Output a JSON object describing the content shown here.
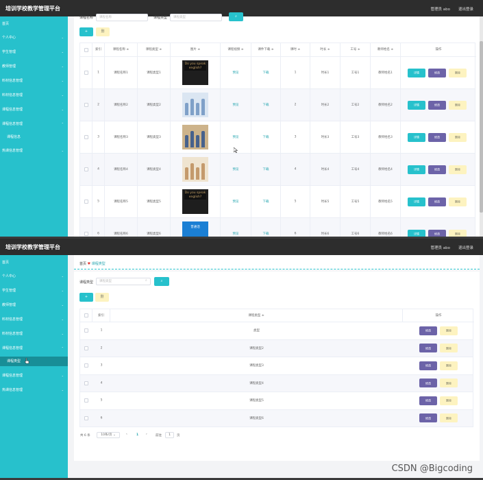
{
  "app": {
    "title": "培训学校教学管理平台",
    "user": "管理员 abo",
    "logout": "退出登录"
  },
  "sidebar1": [
    {
      "label": "首页"
    },
    {
      "label": "个人中心"
    },
    {
      "label": "学生管理"
    },
    {
      "label": "教师管理"
    },
    {
      "label": "料材信息管理"
    },
    {
      "label": "料材信息管理"
    },
    {
      "label": "课程信息管理"
    },
    {
      "label": "课程信息管理"
    },
    {
      "label": "课程信息"
    },
    {
      "label": "热课信息管理"
    }
  ],
  "sidebar2": [
    {
      "label": "首页"
    },
    {
      "label": "个人中心"
    },
    {
      "label": "学生管理"
    },
    {
      "label": "教师管理"
    },
    {
      "label": "料材信息管理"
    },
    {
      "label": "料材信息管理"
    },
    {
      "label": "课程信息管理"
    },
    {
      "label": "课程类型"
    },
    {
      "label": "课程信息管理"
    },
    {
      "label": "热课信息管理"
    }
  ],
  "course": {
    "search": {
      "name_label": "课程名称",
      "name_placeholder": "课程名称",
      "type_label": "课程类型",
      "type_placeholder": "课程类型"
    },
    "add_button": "+",
    "delete_button": "删",
    "columns": [
      "索引",
      "课程名称 ≑",
      "课程类型 ≑",
      "图片 ≑",
      "课程视频 ≑",
      "课件下载 ≑",
      "课时 ≑",
      "时长 ≑",
      "工号 ≑",
      "教师姓名 ≑",
      "操作"
    ],
    "rows": [
      {
        "index": "1",
        "name": "课程名称1",
        "type": "课程类型1",
        "video": "预览",
        "download": "下载",
        "hours": "1",
        "duration": "时长1",
        "job": "工号1",
        "teacher": "教师姓名1"
      },
      {
        "index": "2",
        "name": "课程名称2",
        "type": "课程类型2",
        "video": "预览",
        "download": "下载",
        "hours": "2",
        "duration": "时长2",
        "job": "工号2",
        "teacher": "教师姓名2"
      },
      {
        "index": "3",
        "name": "课程名称3",
        "type": "课程类型3",
        "video": "预览",
        "download": "下载",
        "hours": "3",
        "duration": "时长3",
        "job": "工号3",
        "teacher": "教师姓名3"
      },
      {
        "index": "4",
        "name": "课程名称4",
        "type": "课程类型4",
        "video": "预览",
        "download": "下载",
        "hours": "4",
        "duration": "时长4",
        "job": "工号4",
        "teacher": "教师姓名4"
      },
      {
        "index": "5",
        "name": "课程名称5",
        "type": "课程类型5",
        "video": "预览",
        "download": "下载",
        "hours": "5",
        "duration": "时长5",
        "job": "工号5",
        "teacher": "教师姓名5"
      },
      {
        "index": "6",
        "name": "课程名称6",
        "type": "课程类型6",
        "video": "预览",
        "download": "下载",
        "hours": "6",
        "duration": "时长6",
        "job": "工号6",
        "teacher": "教师姓名6"
      }
    ],
    "actions": {
      "detail": "详情",
      "edit": "修改",
      "delete": "删除"
    },
    "thumb_text": [
      "Do you speak english?",
      "",
      "",
      "",
      "Do you speak english?",
      "普通话"
    ]
  },
  "types": {
    "breadcrumb": {
      "home": "首页",
      "sep": "♥",
      "current": "课程类型"
    },
    "search": {
      "label": "课程类型",
      "placeholder": "课程类型"
    },
    "add_button": "+",
    "delete_button": "删",
    "columns": [
      "索引",
      "课程类型 ≑",
      "操作"
    ],
    "rows": [
      {
        "index": "1",
        "type": "类型"
      },
      {
        "index": "2",
        "type": "课程类型2"
      },
      {
        "index": "3",
        "type": "课程类型3"
      },
      {
        "index": "4",
        "type": "课程类型4"
      },
      {
        "index": "5",
        "type": "课程类型5"
      },
      {
        "index": "6",
        "type": "课程类型6"
      }
    ],
    "actions": {
      "edit": "修改",
      "delete": "删除"
    },
    "pager": {
      "total": "共 6 条",
      "page_size": "10条/页",
      "prev": "‹",
      "current": "1",
      "next": "›",
      "goto_label": "前往",
      "goto_value": "1",
      "goto_suffix": "页"
    }
  },
  "watermark": "CSDN @Bigcoding"
}
